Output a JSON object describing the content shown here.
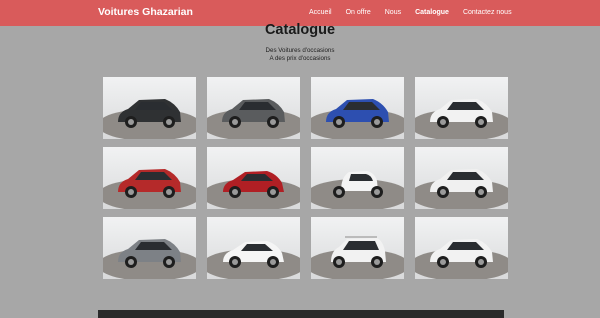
{
  "colors": {
    "navbar": "#d95b5b",
    "page_bg": "#a7a7a7",
    "footer": "#2a2a2a"
  },
  "navbar": {
    "brand": "Voitures Ghazarian",
    "links": [
      {
        "label": "Accueil",
        "active": false
      },
      {
        "label": "On offre",
        "active": false
      },
      {
        "label": "Nous",
        "active": false
      },
      {
        "label": "Catalogue",
        "active": true
      },
      {
        "label": "Contactez nous",
        "active": false
      }
    ]
  },
  "header": {
    "title": "Catalogue",
    "subtitle_line1": "Des Voitures d'occasions",
    "subtitle_line2": "A des prix d'occasions"
  },
  "catalog": {
    "cars": [
      {
        "color": "#2f3133",
        "type": "suv"
      },
      {
        "color": "#5a5c5e",
        "type": "suv"
      },
      {
        "color": "#2d4fb0",
        "type": "suv"
      },
      {
        "color": "#f2f2f2",
        "type": "suv"
      },
      {
        "color": "#b52a2a",
        "type": "suv"
      },
      {
        "color": "#b01f24",
        "type": "hatch"
      },
      {
        "color": "#f4f4f4",
        "type": "mini"
      },
      {
        "color": "#f0f0f0",
        "type": "suv"
      },
      {
        "color": "#7d8186",
        "type": "suv"
      },
      {
        "color": "#f5f5f5",
        "type": "hatch"
      },
      {
        "color": "#f2f2f2",
        "type": "van"
      },
      {
        "color": "#f2f2f2",
        "type": "suv"
      }
    ]
  }
}
